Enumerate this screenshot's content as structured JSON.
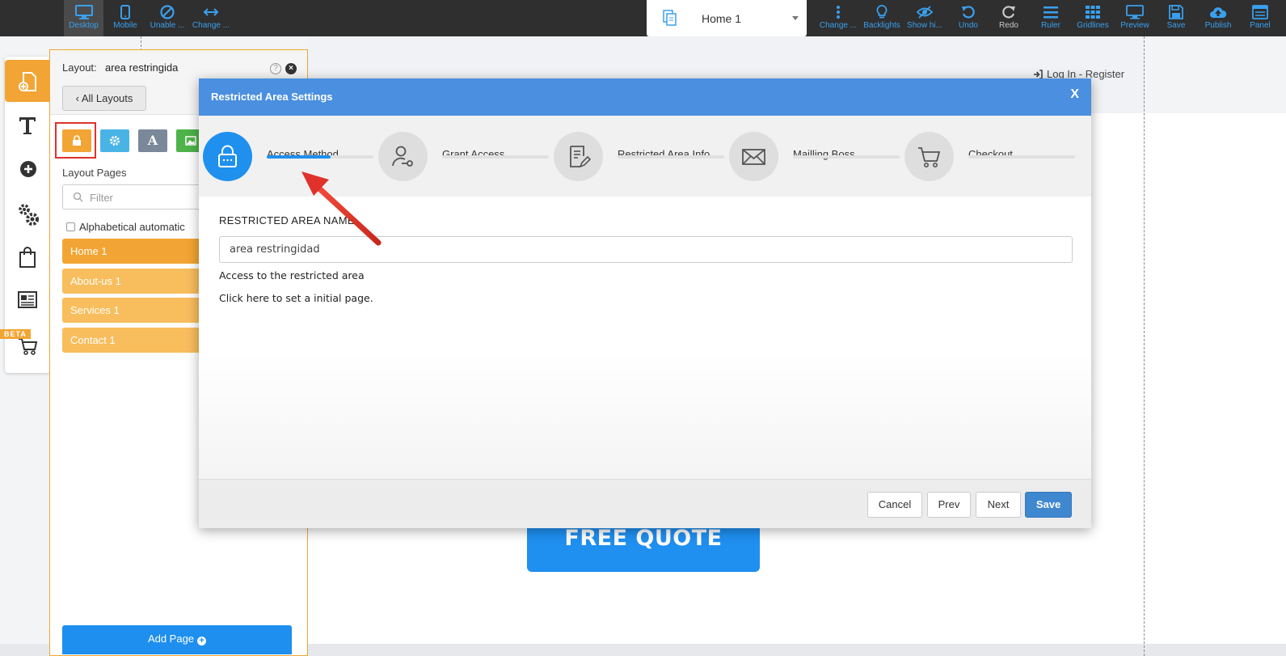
{
  "toolbar": {
    "left": [
      {
        "label": "Desktop",
        "icon": "desktop-icon"
      },
      {
        "label": "Mobile",
        "icon": "mobile-icon"
      },
      {
        "label": "Unable ...",
        "icon": "ban-icon"
      },
      {
        "label": "Change ...",
        "icon": "arrows-horizontal-icon"
      }
    ],
    "page_select": "Home 1",
    "right": [
      {
        "label": "Change ...",
        "icon": "vertical-dots-icon"
      },
      {
        "label": "Backlights",
        "icon": "lightbulb-icon"
      },
      {
        "label": "Show hi...",
        "icon": "eye-slash-icon"
      },
      {
        "label": "Undo",
        "icon": "undo-icon"
      },
      {
        "label": "Redo",
        "icon": "redo-icon"
      },
      {
        "label": "Ruler",
        "icon": "ruler-icon"
      },
      {
        "label": "Gridlines",
        "icon": "grid-icon"
      },
      {
        "label": "Preview",
        "icon": "monitor-icon"
      },
      {
        "label": "Save",
        "icon": "floppy-icon"
      },
      {
        "label": "Publish",
        "icon": "cloud-upload-icon"
      },
      {
        "label": "Panel",
        "icon": "panel-icon"
      }
    ]
  },
  "canvas": {
    "login": "Log In - Register",
    "free_quote": "FREE QUOTE"
  },
  "iconbar": {
    "beta": "BETA"
  },
  "layout_panel": {
    "layout_label": "Layout:",
    "layout_name": "area restringida",
    "help": "?",
    "close": "×",
    "all_layouts": "All Layouts",
    "font_tab": "A",
    "pages_title": "Layout Pages",
    "filter_placeholder": "Filter",
    "alphabetical": "Alphabetical automatic",
    "pages": [
      "Home 1",
      "About-us 1",
      "Services 1",
      "Contact 1"
    ],
    "add_page": "Add Page"
  },
  "modal": {
    "title": "Restricted Area Settings",
    "close": "X",
    "steps": [
      {
        "label": "Access Method",
        "icon": "lock-icon",
        "progress": 0.6
      },
      {
        "label": "Grant Access",
        "icon": "user-key-icon",
        "progress": 0
      },
      {
        "label": "Restricted Area Info",
        "icon": "document-edit-icon",
        "progress": 0
      },
      {
        "label": "Mailling Boss",
        "icon": "envelope-icon",
        "progress": 0
      },
      {
        "label": "Checkout",
        "icon": "cart-icon",
        "progress": 0
      }
    ],
    "field_label": "RESTRICTED AREA NAME",
    "field_value": "area restringidad",
    "access_text": "Access to the restricted area",
    "initial_page_text": "Click here to set a initial page.",
    "buttons": {
      "cancel": "Cancel",
      "prev": "Prev",
      "next": "Next",
      "save": "Save"
    }
  },
  "colors": {
    "accent_blue": "#1f90ee",
    "header_blue": "#4a8fe0",
    "orange": "#f2a534",
    "annotation_red": "#e0322a"
  }
}
